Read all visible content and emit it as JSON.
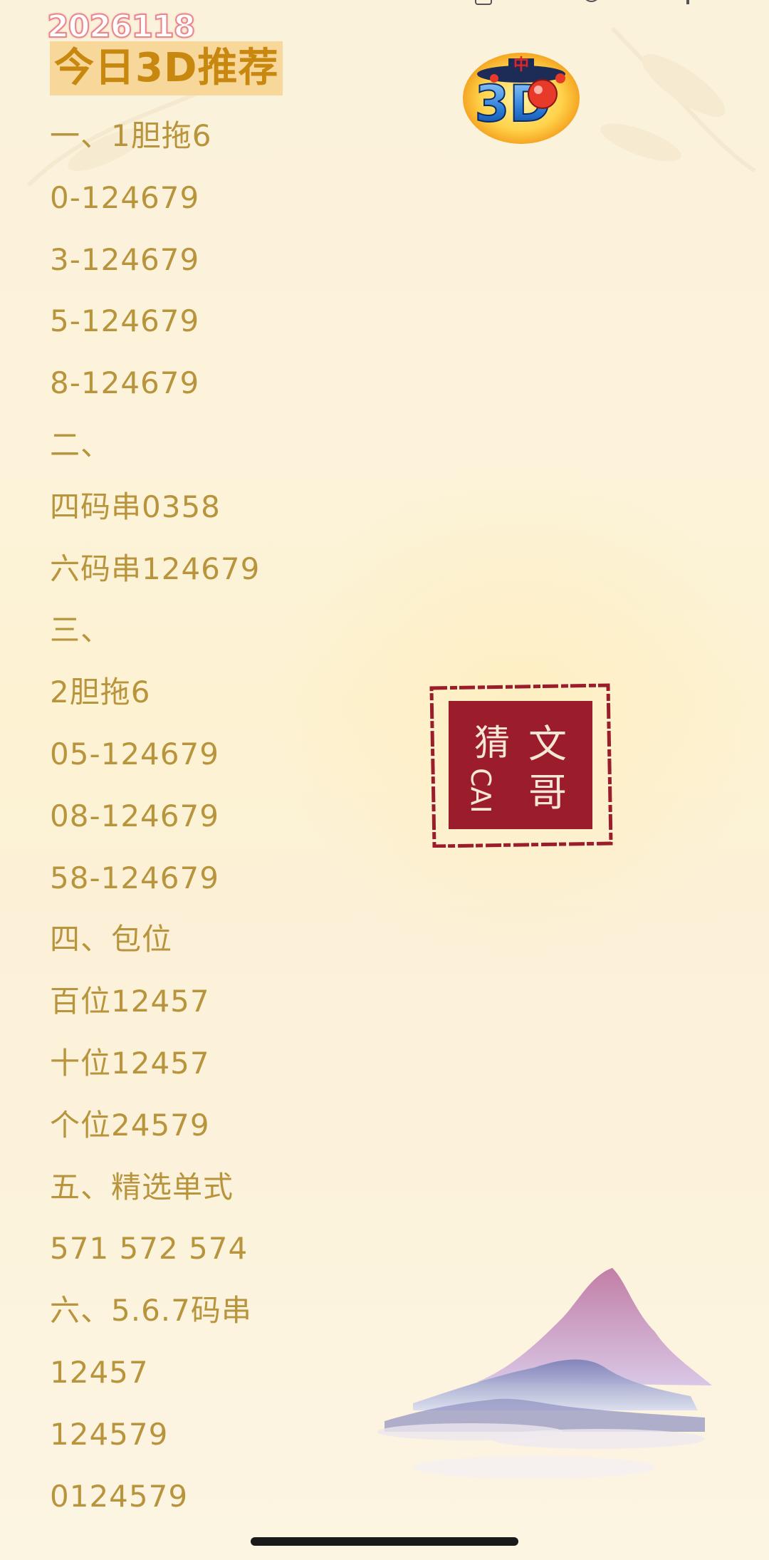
{
  "date_stamp": "2026118",
  "title": "今日3D推荐",
  "logo": {
    "top_char": "中",
    "main_text": "3D"
  },
  "lines": [
    "一、1胆拖6",
    "0-124679",
    "3-124679",
    "5-124679",
    "8-124679",
    "二、",
    "四码串0358",
    "六码串124679",
    "三、",
    "2胆拖6",
    "05-124679",
    "08-124679",
    "58-124679",
    "四、包位",
    "百位12457",
    "十位12457",
    "个位24579",
    "五、精选单式",
    "571 572 574",
    "六、5.6.7码串",
    "12457",
    "124579",
    "0124579"
  ],
  "seal": {
    "right_col": [
      "文",
      "哥"
    ],
    "left_col": [
      "猜",
      "CAI"
    ]
  },
  "colors": {
    "text": "#b8953c",
    "title": "#c8880f",
    "title_bg": "#f7d79a",
    "seal": "#9b1d2b",
    "background": "#fcf3da"
  }
}
